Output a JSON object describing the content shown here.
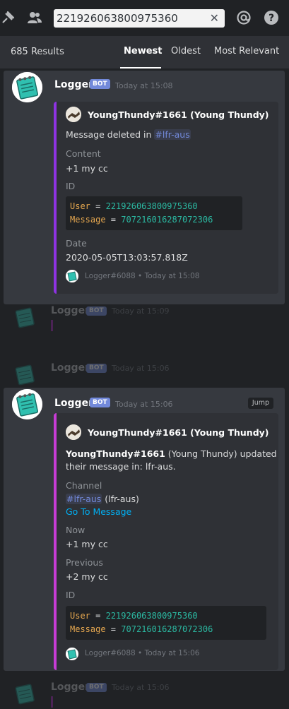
{
  "search": {
    "query": "221926063800975360"
  },
  "results": {
    "count_label": "685 Results",
    "tabs": [
      "Newest",
      "Oldest",
      "Most Relevant"
    ],
    "active_tab": "Newest"
  },
  "card1": {
    "author": "Logger",
    "bot_tag": "BOT",
    "timestamp": "Today at 15:08",
    "embed_author": "YoungThundy#1661 (Young Thundy)",
    "desc_prefix": "Message deleted in ",
    "desc_channel": "#lfr-aus",
    "fields": [
      {
        "name": "Content",
        "value": "+1 my cc"
      },
      {
        "name": "ID",
        "value": ""
      },
      {
        "name": "Date",
        "value": "2020-05-05T13:03:57.818Z"
      }
    ],
    "code": [
      {
        "key": "User",
        "eq": " = ",
        "value": "221926063800975360"
      },
      {
        "key": "Message",
        "eq": " = ",
        "value": "707216016287072306"
      }
    ],
    "footer": "Logger#6088",
    "footer_sep": " • ",
    "footer_time": "Today at 15:08",
    "accent": "#8e33e2"
  },
  "ghost1": {
    "author": "Logger",
    "bot_tag": "BOT",
    "timestamp": "Today at 15:09"
  },
  "ghost2": {
    "author": "Logger",
    "bot_tag": "BOT",
    "timestamp": "Today at 15:06"
  },
  "card2": {
    "author": "Logger",
    "bot_tag": "BOT",
    "timestamp": "Today at 15:06",
    "jump_label": "Jump",
    "embed_author": "YoungThundy#1661 (Young Thundy)",
    "desc_bold": "YoungThundy#1661",
    "desc_rest": " (Young Thundy) updated",
    "desc_line2": "their message in: lfr-aus.",
    "channel_label": "Channel",
    "channel_mention": "#lfr-aus",
    "channel_paren": " (lfr-aus)",
    "go_to": "Go To Message",
    "now_label": "Now",
    "now_value": "+1 my cc",
    "prev_label": "Previous",
    "prev_value": "+2 my cc",
    "id_label": "ID",
    "code": [
      {
        "key": "User",
        "eq": " = ",
        "value": "221926063800975360"
      },
      {
        "key": "Message",
        "eq": " = ",
        "value": "707216016287072306"
      }
    ],
    "footer": "Logger#6088",
    "footer_sep": " • ",
    "footer_time": "Today at 15:06",
    "accent": "#c73cd5"
  },
  "ghost3": {
    "author": "Logger",
    "bot_tag": "BOT",
    "timestamp": "Today at 15:06"
  }
}
